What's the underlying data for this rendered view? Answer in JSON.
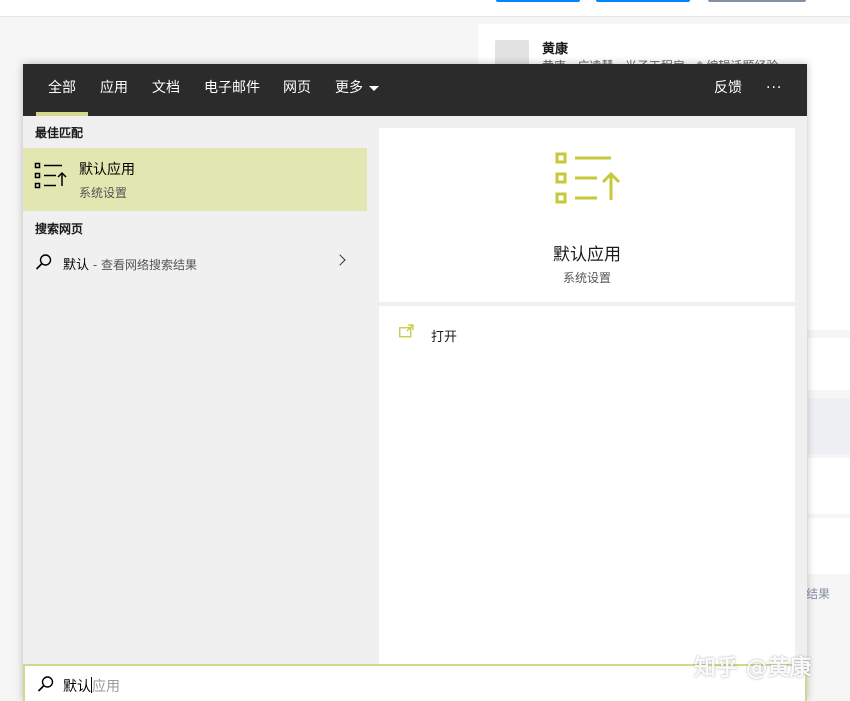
{
  "background": {
    "profile_name": "黄康",
    "profile_sub": "黄康 · 广凌慧 · 光子工程房 · ✎编辑话题经验",
    "result_text": "结果",
    "watermark": "知乎 @黄康"
  },
  "tabs": [
    {
      "label": "全部",
      "active": true
    },
    {
      "label": "应用"
    },
    {
      "label": "文档"
    },
    {
      "label": "电子邮件"
    },
    {
      "label": "网页"
    },
    {
      "label": "更多"
    }
  ],
  "header": {
    "feedback": "反馈",
    "more_options": "···"
  },
  "best_match": {
    "heading": "最佳匹配",
    "title": "默认应用",
    "subtitle": "系统设置",
    "icon": "default-apps-icon"
  },
  "web": {
    "heading": "搜索网页",
    "query": "默认",
    "hint": " - 查看网络搜索结果"
  },
  "detail": {
    "title": "默认应用",
    "subtitle": "系统设置",
    "open_label": "打开",
    "accent": "#c6c93a"
  },
  "search": {
    "typed": "默认",
    "suggestion": "应用"
  }
}
